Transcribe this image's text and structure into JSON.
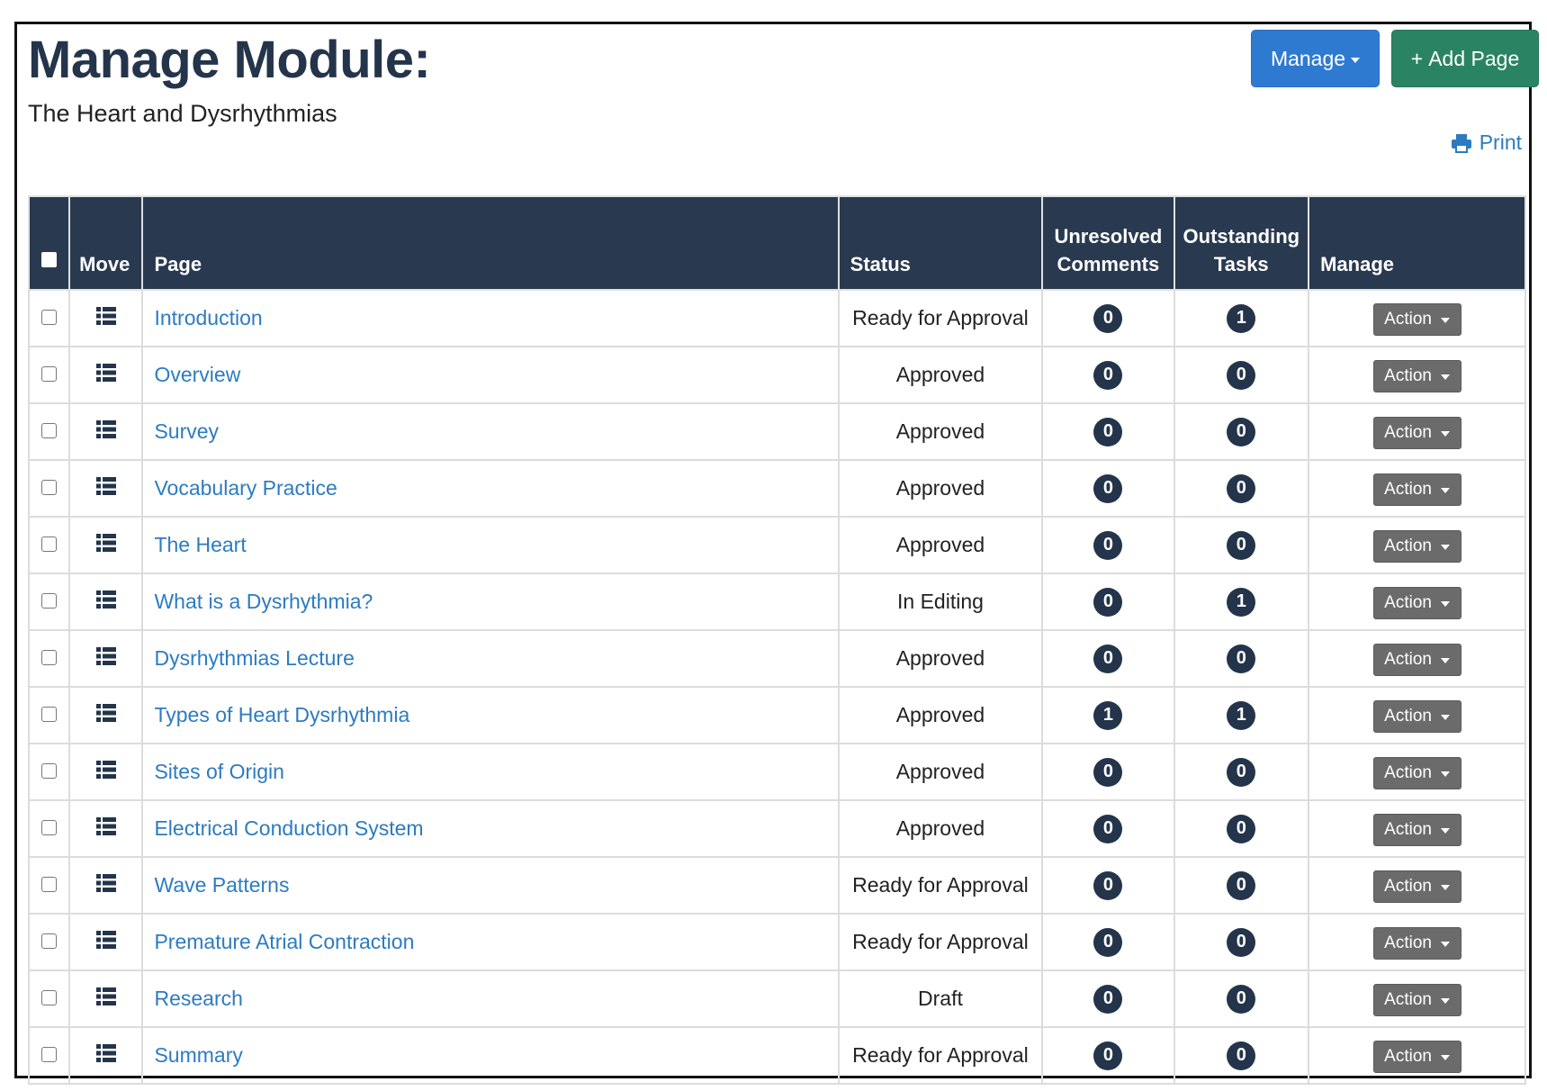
{
  "header": {
    "title": "Manage Module:",
    "subtitle": "The Heart and Dysrhythmias",
    "manage_label": "Manage",
    "add_page_label": "Add Page",
    "add_page_prefix": "+",
    "print_label": "Print"
  },
  "table": {
    "columns": {
      "move": "Move",
      "page": "Page",
      "status": "Status",
      "comments_line1": "Unresolved",
      "comments_line2": "Comments",
      "tasks_line1": "Outstanding",
      "tasks_line2": "Tasks",
      "manage": "Manage"
    },
    "action_label": "Action",
    "rows": [
      {
        "page": "Introduction",
        "status": "Ready for Approval",
        "comments": "0",
        "tasks": "1"
      },
      {
        "page": "Overview",
        "status": "Approved",
        "comments": "0",
        "tasks": "0"
      },
      {
        "page": "Survey",
        "status": "Approved",
        "comments": "0",
        "tasks": "0"
      },
      {
        "page": "Vocabulary Practice",
        "status": "Approved",
        "comments": "0",
        "tasks": "0"
      },
      {
        "page": "The Heart",
        "status": "Approved",
        "comments": "0",
        "tasks": "0"
      },
      {
        "page": "What is a Dysrhythmia?",
        "status": "In Editing",
        "comments": "0",
        "tasks": "1"
      },
      {
        "page": "Dysrhythmias Lecture",
        "status": "Approved",
        "comments": "0",
        "tasks": "0"
      },
      {
        "page": "Types of Heart Dysrhythmia",
        "status": "Approved",
        "comments": "1",
        "tasks": "1"
      },
      {
        "page": "Sites of Origin",
        "status": "Approved",
        "comments": "0",
        "tasks": "0"
      },
      {
        "page": "Electrical Conduction System",
        "status": "Approved",
        "comments": "0",
        "tasks": "0"
      },
      {
        "page": "Wave Patterns",
        "status": "Ready for Approval",
        "comments": "0",
        "tasks": "0"
      },
      {
        "page": "Premature Atrial Contraction",
        "status": "Ready for Approval",
        "comments": "0",
        "tasks": "0"
      },
      {
        "page": "Research",
        "status": "Draft",
        "comments": "0",
        "tasks": "0"
      },
      {
        "page": "Summary",
        "status": "Ready for Approval",
        "comments": "0",
        "tasks": "0"
      }
    ]
  },
  "icons": {
    "move": "list-icon",
    "print": "printer-icon",
    "dropdown": "caret-down-icon"
  },
  "colors": {
    "header_bg": "#293a50",
    "link": "#2d7bc1",
    "manage_button": "#2f7ad1",
    "add_button": "#2a8464",
    "action_button": "#6b6b6b",
    "badge": "#24344a"
  }
}
